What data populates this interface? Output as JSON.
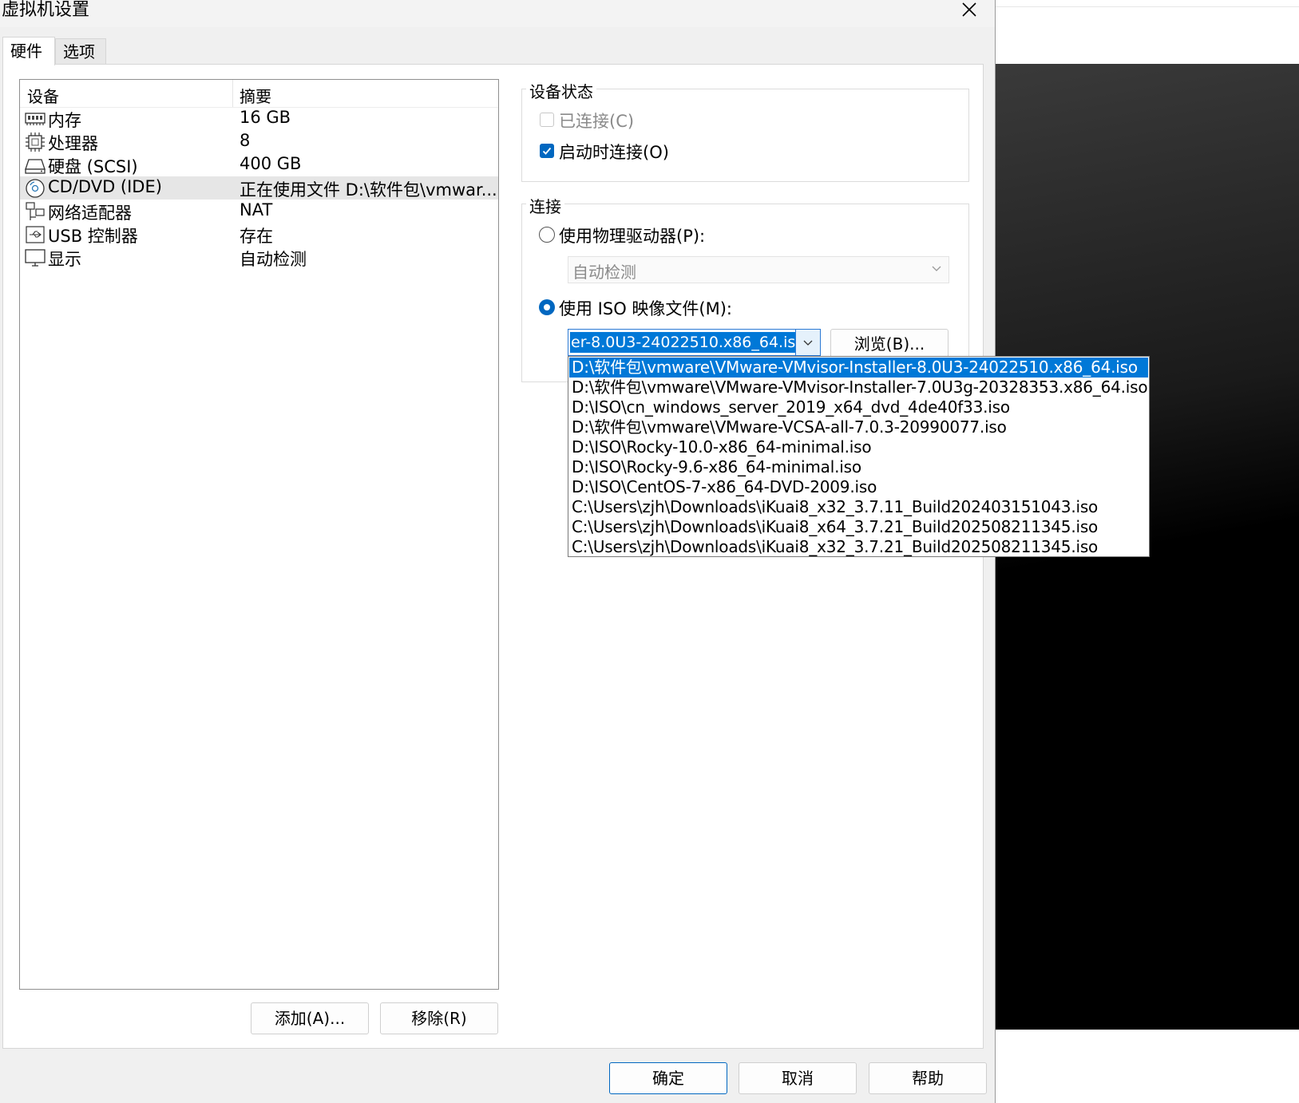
{
  "dialog": {
    "title": "虚拟机设置",
    "tabs": [
      {
        "label": "硬件",
        "active": true
      },
      {
        "label": "选项",
        "active": false
      }
    ]
  },
  "device_list": {
    "headers": {
      "device": "设备",
      "summary": "摘要"
    },
    "rows": [
      {
        "icon": "memory-icon",
        "name": "内存",
        "summary": "16 GB"
      },
      {
        "icon": "processor-icon",
        "name": "处理器",
        "summary": "8"
      },
      {
        "icon": "harddisk-icon",
        "name": "硬盘 (SCSI)",
        "summary": "400 GB"
      },
      {
        "icon": "cdrom-icon",
        "name": "CD/DVD (IDE)",
        "summary": "正在使用文件 D:\\软件包\\vmwar...",
        "selected": true
      },
      {
        "icon": "network-icon",
        "name": "网络适配器",
        "summary": "NAT"
      },
      {
        "icon": "usb-icon",
        "name": "USB 控制器",
        "summary": "存在"
      },
      {
        "icon": "display-icon",
        "name": "显示",
        "summary": "自动检测"
      }
    ],
    "add_label": "添加(A)...",
    "remove_label": "移除(R)"
  },
  "device_status": {
    "title": "设备状态",
    "connected_label": "已连接(C)",
    "connected": false,
    "connect_on_power_label": "启动时连接(O)",
    "connect_on_power": true
  },
  "connection": {
    "title": "连接",
    "physical_label": "使用物理驱动器(P):",
    "physical_selected": false,
    "physical_value": "自动检测",
    "iso_label": "使用 ISO 映像文件(M):",
    "iso_selected": true,
    "iso_value": "er-8.0U3-24022510.x86_64.iso",
    "browse_label": "浏览(B)...",
    "iso_history": [
      "D:\\软件包\\vmware\\VMware-VMvisor-Installer-8.0U3-24022510.x86_64.iso",
      "D:\\软件包\\vmware\\VMware-VMvisor-Installer-7.0U3g-20328353.x86_64.iso",
      "D:\\ISO\\cn_windows_server_2019_x64_dvd_4de40f33.iso",
      "D:\\软件包\\vmware\\VMware-VCSA-all-7.0.3-20990077.iso",
      "D:\\ISO\\Rocky-10.0-x86_64-minimal.iso",
      "D:\\ISO\\Rocky-9.6-x86_64-minimal.iso",
      "D:\\ISO\\CentOS-7-x86_64-DVD-2009.iso",
      "C:\\Users\\zjh\\Downloads\\iKuai8_x32_3.7.11_Build202403151043.iso",
      "C:\\Users\\zjh\\Downloads\\iKuai8_x64_3.7.21_Build202508211345.iso",
      "C:\\Users\\zjh\\Downloads\\iKuai8_x32_3.7.21_Build202508211345.iso"
    ]
  },
  "footer": {
    "ok_label": "确定",
    "cancel_label": "取消",
    "help_label": "帮助"
  },
  "colors": {
    "accent": "#0078d7",
    "dialog_bg": "#f0f0f0",
    "selected_row": "#e6e6e6"
  }
}
